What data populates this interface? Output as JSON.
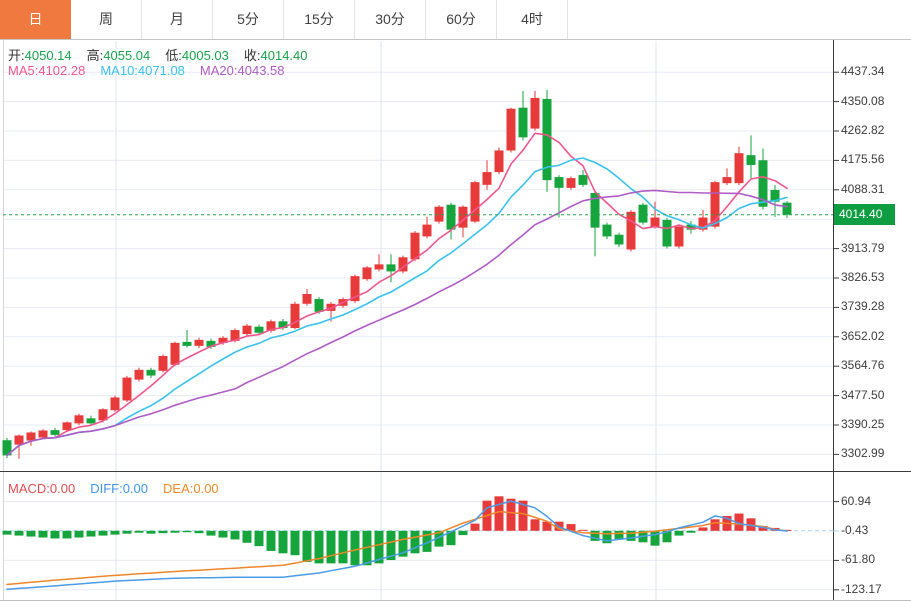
{
  "tabs": {
    "items": [
      {
        "label": "日",
        "active": true
      },
      {
        "label": "周",
        "active": false
      },
      {
        "label": "月",
        "active": false
      },
      {
        "label": "5分",
        "active": false
      },
      {
        "label": "15分",
        "active": false
      },
      {
        "label": "30分",
        "active": false
      },
      {
        "label": "60分",
        "active": false
      },
      {
        "label": "4时",
        "active": false
      }
    ]
  },
  "legend": {
    "open_label": "开:",
    "open": "4050.14",
    "high_label": "高:",
    "high": "4055.04",
    "low_label": "低:",
    "low": "4005.03",
    "close_label": "收:",
    "close": "4014.40",
    "ma5_label": "MA5:",
    "ma5": "4102.28",
    "ma10_label": "MA10:",
    "ma10": "4071.08",
    "ma20_label": "MA20:",
    "ma20": "4043.58",
    "macd_label": "MACD:",
    "macd": "0.00",
    "diff_label": "DIFF:",
    "diff": "0.00",
    "dea_label": "DEA:",
    "dea": "0.00"
  },
  "price_label": {
    "value": "4014.40"
  },
  "colors": {
    "up": "#e73a3a",
    "down": "#16a53c",
    "ma5": "#f0568e",
    "ma10": "#38c2ee",
    "ma20": "#b05cc6",
    "diff_line": "#4a9ce8",
    "dea_line": "#f0862a",
    "dotted_price_line": "#26a348",
    "price_tag_bg": "#0e9e41",
    "zero_dash": "#a8d2f0",
    "grid": "#e7ecf3",
    "vgrid": "#dde6f0",
    "axis": "#3c3c3c",
    "active_tab": "#f0793f"
  },
  "chart_data": {
    "type": "candlestick+macd",
    "title": "",
    "timeframe_selected": "日",
    "current_price": 4014.4,
    "price_axis": {
      "tick_labels": [
        "4437.34",
        "4350.08",
        "4262.82",
        "4175.56",
        "4088.31",
        "3913.79",
        "3826.53",
        "3739.28",
        "3652.02",
        "3564.76",
        "3477.50",
        "3390.25",
        "3302.99"
      ],
      "extra_gridlines": [
        4001.05
      ],
      "tick_step": 87.26
    },
    "candles": [
      [
        3345,
        3352,
        3292,
        3300
      ],
      [
        3332,
        3362,
        3290,
        3359
      ],
      [
        3344,
        3371,
        3329,
        3368
      ],
      [
        3353,
        3378,
        3348,
        3374
      ],
      [
        3375,
        3382,
        3356,
        3361
      ],
      [
        3375,
        3401,
        3370,
        3398
      ],
      [
        3395,
        3424,
        3390,
        3419
      ],
      [
        3410,
        3418,
        3388,
        3395
      ],
      [
        3404,
        3440,
        3398,
        3437
      ],
      [
        3434,
        3477,
        3430,
        3472
      ],
      [
        3463,
        3536,
        3458,
        3531
      ],
      [
        3525,
        3560,
        3519,
        3554
      ],
      [
        3554,
        3560,
        3530,
        3537
      ],
      [
        3551,
        3600,
        3546,
        3595
      ],
      [
        3569,
        3638,
        3565,
        3634
      ],
      [
        3637,
        3672,
        3620,
        3625
      ],
      [
        3625,
        3649,
        3618,
        3643
      ],
      [
        3640,
        3647,
        3616,
        3622
      ],
      [
        3634,
        3654,
        3628,
        3649
      ],
      [
        3640,
        3677,
        3635,
        3672
      ],
      [
        3660,
        3690,
        3654,
        3685
      ],
      [
        3682,
        3688,
        3658,
        3664
      ],
      [
        3670,
        3703,
        3664,
        3698
      ],
      [
        3698,
        3705,
        3672,
        3678
      ],
      [
        3678,
        3756,
        3674,
        3750
      ],
      [
        3750,
        3794,
        3744,
        3779
      ],
      [
        3764,
        3770,
        3720,
        3726
      ],
      [
        3729,
        3755,
        3697,
        3750
      ],
      [
        3744,
        3769,
        3738,
        3764
      ],
      [
        3758,
        3837,
        3752,
        3832
      ],
      [
        3823,
        3862,
        3818,
        3858
      ],
      [
        3852,
        3897,
        3846,
        3867
      ],
      [
        3867,
        3897,
        3814,
        3846
      ],
      [
        3846,
        3893,
        3840,
        3888
      ],
      [
        3882,
        3966,
        3876,
        3961
      ],
      [
        3950,
        4008,
        3944,
        3985
      ],
      [
        3994,
        4043,
        3988,
        4038
      ],
      [
        4044,
        4050,
        3941,
        3970
      ],
      [
        3976,
        4042,
        3947,
        4038
      ],
      [
        3994,
        4115,
        3990,
        4111
      ],
      [
        4103,
        4176,
        4088,
        4141
      ],
      [
        4141,
        4214,
        4135,
        4205
      ],
      [
        4205,
        4332,
        4199,
        4329
      ],
      [
        4332,
        4382,
        4235,
        4244
      ],
      [
        4270,
        4382,
        4264,
        4361
      ],
      [
        4358,
        4385,
        4082,
        4117
      ],
      [
        4126,
        4132,
        4006,
        4094
      ],
      [
        4094,
        4128,
        4088,
        4123
      ],
      [
        4132,
        4147,
        4097,
        4103
      ],
      [
        4079,
        4085,
        3891,
        3976
      ],
      [
        3985,
        3991,
        3942,
        3950
      ],
      [
        3955,
        3961,
        3918,
        3926
      ],
      [
        3911,
        4028,
        3905,
        4023
      ],
      [
        4044,
        4050,
        3985,
        3991
      ],
      [
        3979,
        4053,
        3973,
        4006
      ],
      [
        3999,
        4005,
        3914,
        3920
      ],
      [
        3920,
        3984,
        3914,
        3979
      ],
      [
        3985,
        3996,
        3958,
        3970
      ],
      [
        3970,
        4029,
        3964,
        4006
      ],
      [
        3979,
        4115,
        3973,
        4111
      ],
      [
        4108,
        4152,
        4102,
        4126
      ],
      [
        4108,
        4217,
        4102,
        4197
      ],
      [
        4191,
        4250,
        4123,
        4162
      ],
      [
        4176,
        4211,
        4030,
        4038
      ],
      [
        4088,
        4103,
        4008,
        4053
      ],
      [
        4050.14,
        4055.04,
        4005.03,
        4014.4
      ]
    ],
    "ma_periods": [
      5,
      10,
      20
    ],
    "macd": {
      "tick_labels": [
        "60.94",
        "-0.43",
        "-61.80",
        "-123.17"
      ],
      "histogram": [
        -8,
        -10,
        -12,
        -14,
        -16,
        -16,
        -14,
        -12,
        -10,
        -8,
        -6,
        -4,
        -6,
        -5,
        -4,
        -3,
        -5,
        -10,
        -14,
        -18,
        -25,
        -32,
        -42,
        -47,
        -51,
        -65,
        -68,
        -68,
        -68,
        -72,
        -72,
        -68,
        -61,
        -54,
        -47,
        -44,
        -33,
        -30,
        -9,
        15,
        63,
        72,
        67,
        63,
        24,
        19,
        19,
        14,
        2,
        -21,
        -26,
        -17,
        -21,
        -24,
        -31,
        -24,
        -10,
        -4,
        7,
        24,
        31,
        36,
        26,
        10,
        6,
        2
      ],
      "diff_points": [
        [
          0,
          -122
        ],
        [
          4,
          -115
        ],
        [
          9,
          -105
        ],
        [
          14,
          -99
        ],
        [
          19,
          -97
        ],
        [
          23,
          -97
        ],
        [
          26,
          -88
        ],
        [
          29,
          -74
        ],
        [
          33,
          -46
        ],
        [
          35,
          -25
        ],
        [
          37,
          -2
        ],
        [
          39,
          22
        ],
        [
          40,
          48
        ],
        [
          42,
          62
        ],
        [
          44,
          48
        ],
        [
          45,
          30
        ],
        [
          46,
          8
        ],
        [
          48,
          -10
        ],
        [
          50,
          -21
        ],
        [
          52,
          -15
        ],
        [
          54,
          -8
        ],
        [
          55,
          -2
        ],
        [
          56,
          6
        ],
        [
          58,
          18
        ],
        [
          59,
          31
        ],
        [
          60,
          26
        ],
        [
          61,
          15
        ],
        [
          63,
          7
        ],
        [
          64,
          2
        ],
        [
          65,
          -0.4
        ]
      ],
      "dea_points": [
        [
          0,
          -112
        ],
        [
          4,
          -103
        ],
        [
          9,
          -93
        ],
        [
          14,
          -85
        ],
        [
          19,
          -78
        ],
        [
          23,
          -72
        ],
        [
          26,
          -58
        ],
        [
          29,
          -40
        ],
        [
          33,
          -18
        ],
        [
          36,
          -4
        ],
        [
          38,
          16
        ],
        [
          40,
          32
        ],
        [
          41,
          40
        ],
        [
          43,
          36
        ],
        [
          45,
          20
        ],
        [
          46,
          4
        ],
        [
          48,
          -4
        ],
        [
          50,
          -6
        ],
        [
          52,
          -5
        ],
        [
          54,
          -1
        ],
        [
          55,
          2
        ],
        [
          56,
          5
        ],
        [
          58,
          11
        ],
        [
          59,
          17
        ],
        [
          61,
          14
        ],
        [
          63,
          9
        ],
        [
          64,
          3
        ],
        [
          65,
          -0.4
        ]
      ]
    },
    "layout_hints": {
      "vertical_gridlines_x": [
        116,
        381,
        656
      ],
      "grid": true,
      "price_axis_side": "right"
    }
  }
}
